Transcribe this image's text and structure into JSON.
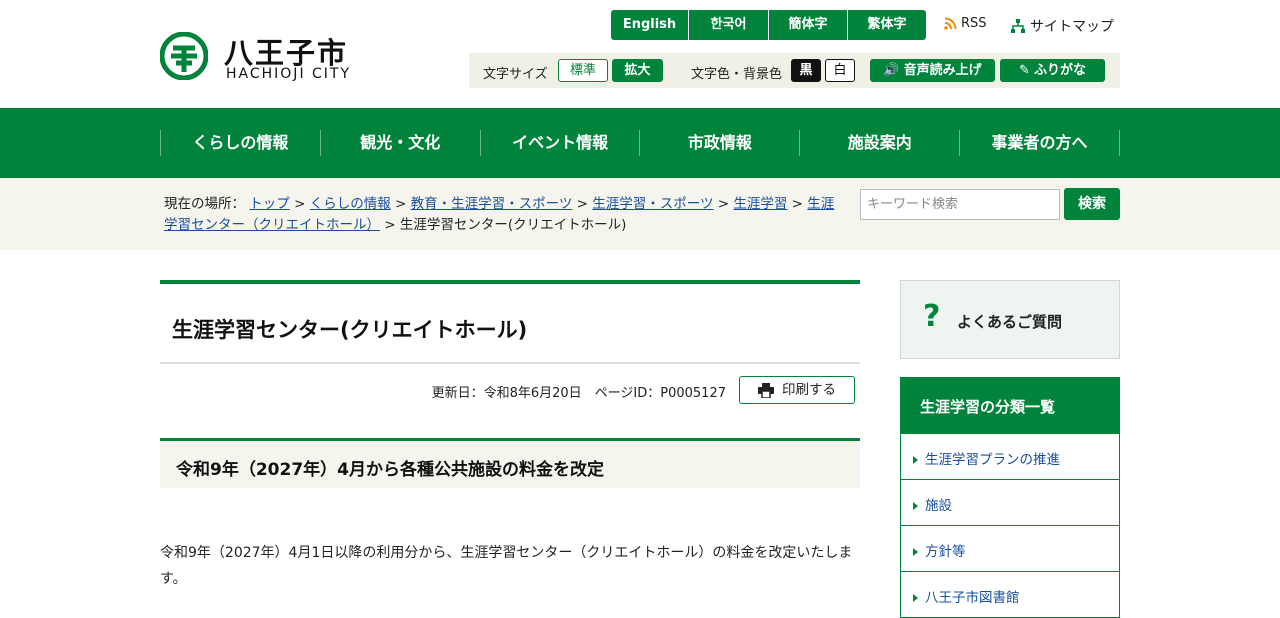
{
  "header": {
    "logo_jp": "八王子市",
    "logo_en": "HACHIOJI CITY",
    "languages": [
      "English",
      "한국어",
      "簡体字",
      "繁体字"
    ],
    "rss": "RSS",
    "sitemap": "サイトマップ"
  },
  "tools": {
    "font_size_label": "文字サイズ",
    "font_standard": "標準",
    "font_large": "拡大",
    "color_label": "文字色・背景色",
    "color_black": "黒",
    "color_white": "白",
    "read_aloud": "音声読み上げ",
    "furigana": "ふりがな"
  },
  "nav": [
    "くらしの情報",
    "観光・文化",
    "イベント情報",
    "市政情報",
    "施設案内",
    "事業者の方へ"
  ],
  "breadcrumb": {
    "prefix": "現在の場所：",
    "links": [
      "トップ",
      "くらしの情報",
      "教育・生涯学習・スポーツ",
      "生涯学習・スポーツ",
      "生涯学習",
      "生涯学習センター（クリエイトホール）"
    ],
    "current": "生涯学習センター(クリエイトホール)"
  },
  "search": {
    "placeholder": "キーワード検索",
    "button": "検索"
  },
  "page": {
    "title": "生涯学習センター(クリエイトホール)",
    "updated": "更新日：令和8年6月20日　ページID：P0005127",
    "print": "印刷する",
    "section_heading": "令和9年（2027年）4月から各種公共施設の料金を改定",
    "body": "令和9年（2027年）4月1日以降の利用分から、生涯学習センター（クリエイトホール）の料金を改定いたします。"
  },
  "sidebar": {
    "faq": "よくあるご質問",
    "heading": "生涯学習の分類一覧",
    "items": [
      "生涯学習プランの推進",
      "施設",
      "方針等",
      "八王子市図書館"
    ]
  },
  "colors": {
    "brand_green": "#00843c",
    "link_blue": "#1a4fa0",
    "beige": "#f5f5ee"
  }
}
